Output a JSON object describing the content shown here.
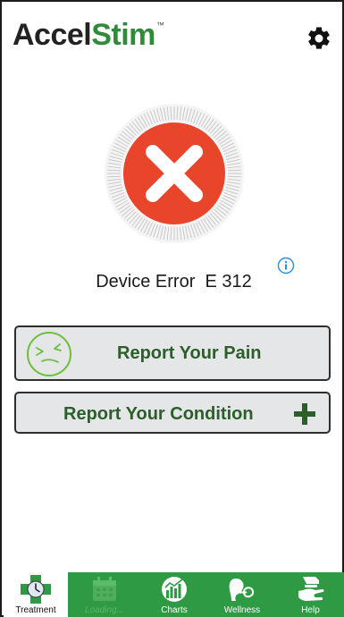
{
  "app": {
    "logo_main": "Accel",
    "logo_accent": "Stim",
    "logo_tm": "™"
  },
  "status": {
    "error_label": "Device Error",
    "error_code": "E 312"
  },
  "buttons": {
    "report_pain": "Report Your Pain",
    "report_condition": "Report Your Condition"
  },
  "nav": [
    {
      "label": "Treatment",
      "icon": "clock-cross-icon",
      "active": true
    },
    {
      "label": "Loading...",
      "icon": "calendar-icon",
      "active": false
    },
    {
      "label": "Charts",
      "icon": "chart-icon",
      "active": false
    },
    {
      "label": "Wellness",
      "icon": "wellness-icon",
      "active": false
    },
    {
      "label": "Help",
      "icon": "help-hand-icon",
      "active": false
    }
  ],
  "colors": {
    "brand_green": "#2e9a44",
    "button_text_green": "#2c5e2a",
    "error_red": "#e8452b",
    "button_bg": "#e4e6e8"
  }
}
